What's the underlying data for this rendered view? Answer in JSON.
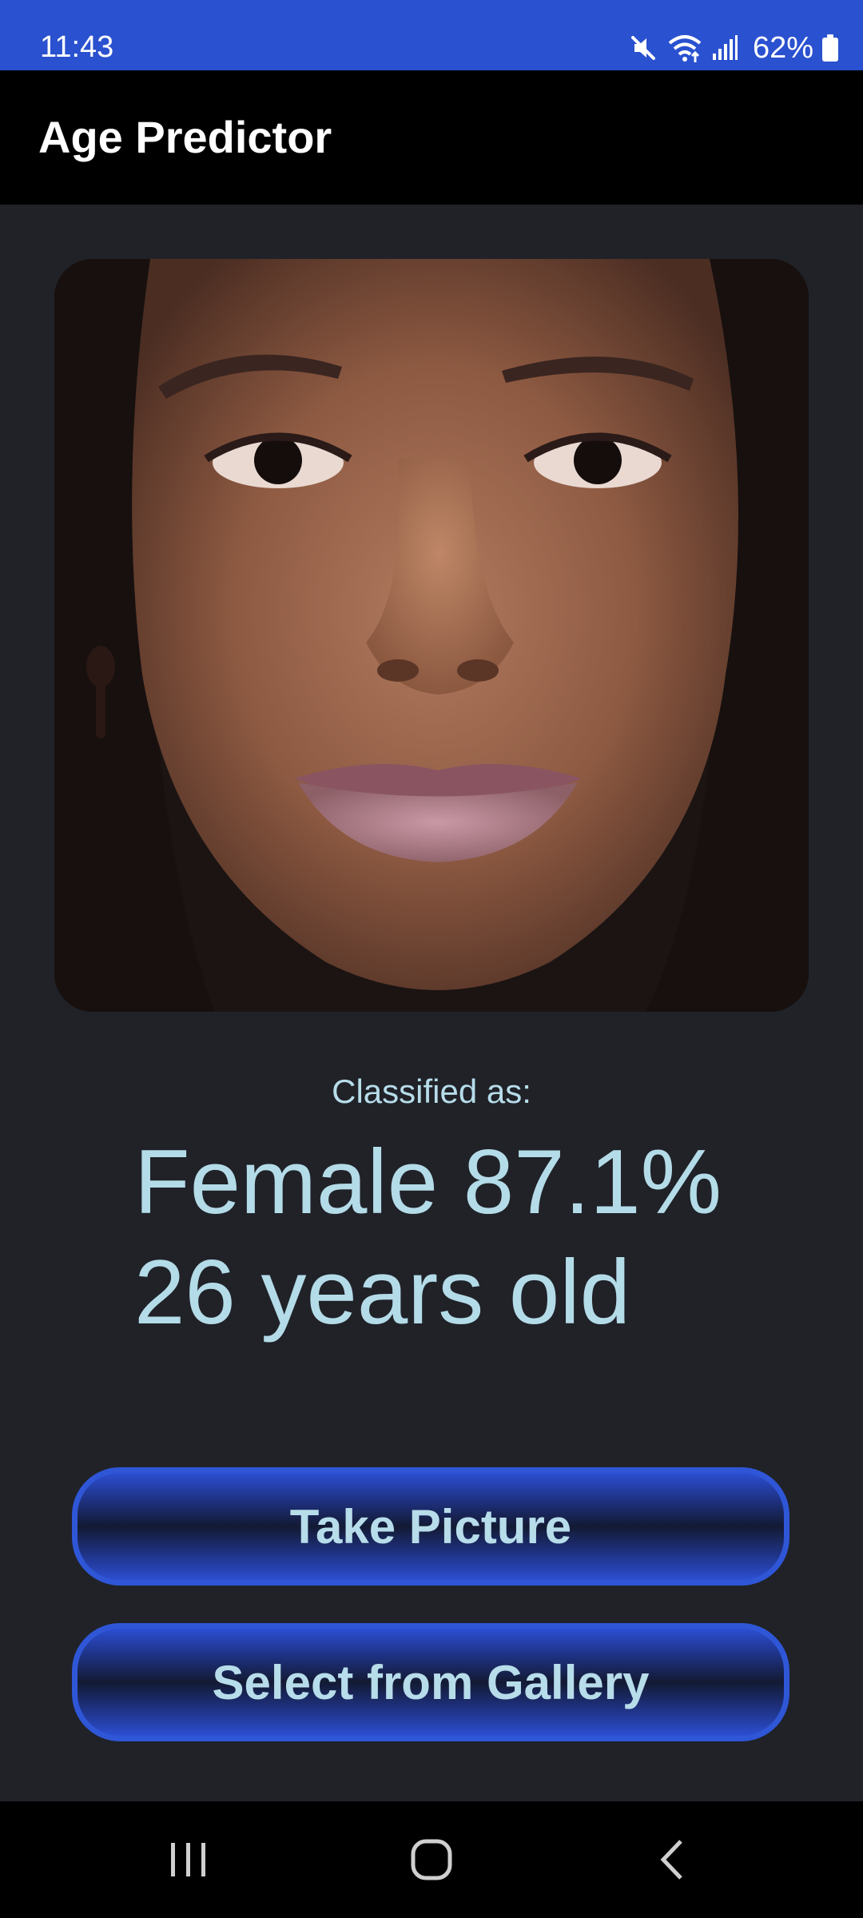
{
  "status_bar": {
    "time": "11:43",
    "battery": "62%",
    "icons": [
      "mute-icon",
      "wifi-icon",
      "signal-icon",
      "battery-icon"
    ],
    "background": "#2a51cf"
  },
  "app_bar": {
    "title": "Age Predictor"
  },
  "photo": {
    "description_icon": "face-photo"
  },
  "result": {
    "label": "Classified as:",
    "gender_line": "Female 87.1%",
    "age_line": "26 years old",
    "text_color": "#b4dbe8"
  },
  "buttons": {
    "take_picture": "Take Picture",
    "select_gallery": "Select from Gallery",
    "accent": "#2f56d6"
  },
  "nav_bar": {
    "icons": [
      "recents-icon",
      "home-icon",
      "back-icon"
    ]
  },
  "colors": {
    "background": "#202228",
    "app_bar": "#000000"
  }
}
